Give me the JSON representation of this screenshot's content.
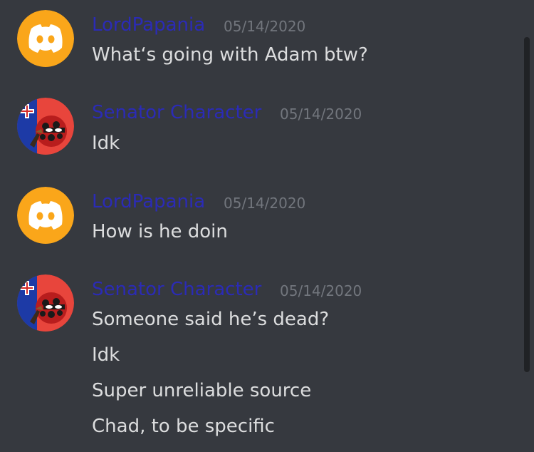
{
  "theme": {
    "background": "#36393f",
    "username_color": "#2b2bb6",
    "timestamp_color": "#72767d",
    "text_color": "#dcddde",
    "discord_avatar_color": "#faa61a"
  },
  "messages": [
    {
      "username": "LordPapania",
      "timestamp": "05/14/2020",
      "avatar_icon": "discord-default-avatar",
      "lines": [
        "What‘s going with Adam btw?"
      ]
    },
    {
      "username": "Senator Character",
      "timestamp": "05/14/2020",
      "avatar_icon": "countryball-avatar",
      "lines": [
        "Idk"
      ]
    },
    {
      "username": "LordPapania",
      "timestamp": "05/14/2020",
      "avatar_icon": "discord-default-avatar",
      "lines": [
        "How is he doin"
      ]
    },
    {
      "username": "Senator Character",
      "timestamp": "05/14/2020",
      "avatar_icon": "countryball-avatar",
      "lines": [
        "Someone said he’s dead?",
        "Idk",
        "Super unreliable source",
        "Chad, to be specific"
      ]
    }
  ]
}
